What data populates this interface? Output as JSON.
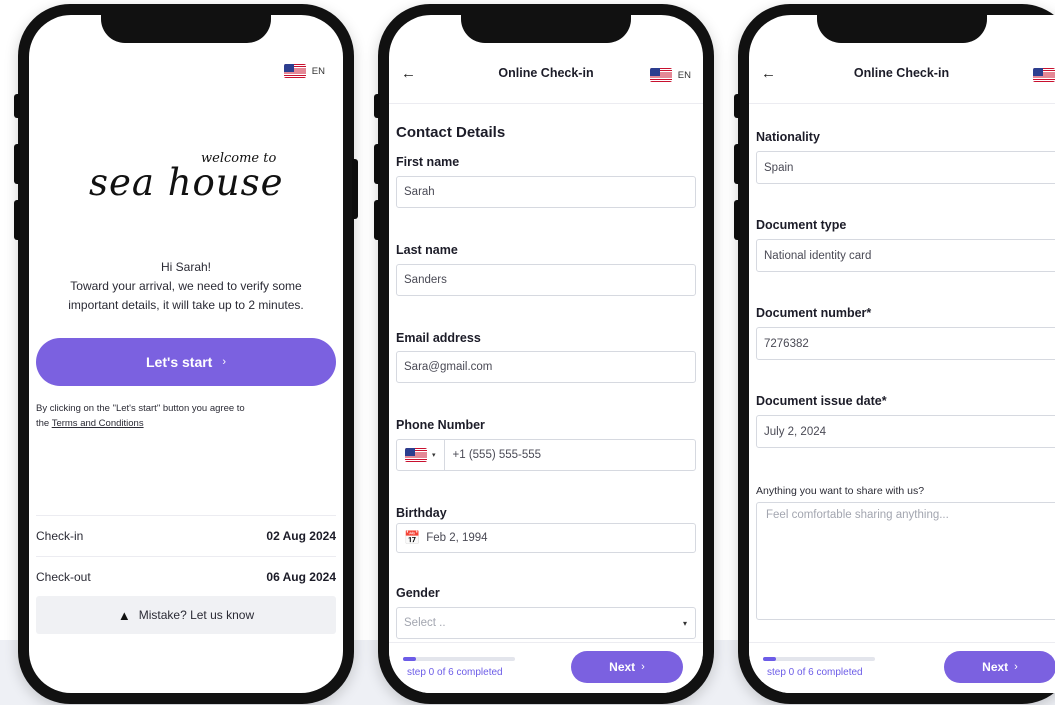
{
  "lang": "EN",
  "welcome": {
    "logo_small": "welcome to",
    "logo_main": "sea house",
    "greeting": "Hi Sarah!",
    "message_1": "Toward your arrival, we need to verify some",
    "message_2": "important details, it will take up to 2 minutes.",
    "start_label": "Let's start",
    "agree_text": "By clicking on the \"Let's start\" button you agree to",
    "agree_prefix": "the",
    "terms_link": "Terms and Conditions",
    "checkin_label": "Check-in",
    "checkin_value": "02 Aug 2024",
    "checkout_label": "Check-out",
    "checkout_value": "06 Aug 2024",
    "mistake_label": "Mistake? Let us know"
  },
  "checkin": {
    "title": "Online Check-in",
    "contact_heading": "Contact Details",
    "first_name_label": "First name",
    "first_name_value": "Sarah",
    "last_name_label": "Last name",
    "last_name_value": "Sanders",
    "email_label": "Email address",
    "email_value": "Sara@gmail.com",
    "phone_label": "Phone Number",
    "phone_value": "+1 (555) 555-555",
    "birthday_label": "Birthday",
    "birthday_value": "Feb 2, 1994",
    "gender_label": "Gender",
    "gender_placeholder": "Select ..",
    "nationality_label": "Nationality",
    "nationality_value": "Spain",
    "doc_type_label": "Document type",
    "doc_type_value": "National identity card",
    "doc_number_label": "Document number*",
    "doc_number_value": "7276382",
    "doc_date_label": "Document issue date*",
    "doc_date_value": "July 2, 2024",
    "share_label": "Anything you want to share with us?",
    "share_placeholder": "Feel comfortable sharing anything...",
    "progress_text": "step 0 of 6 completed",
    "progress_fraction": 0.12,
    "next_label": "Next"
  },
  "colors": {
    "accent": "#7b61e0",
    "text": "#1c1c28",
    "border": "#d6d9e0"
  }
}
